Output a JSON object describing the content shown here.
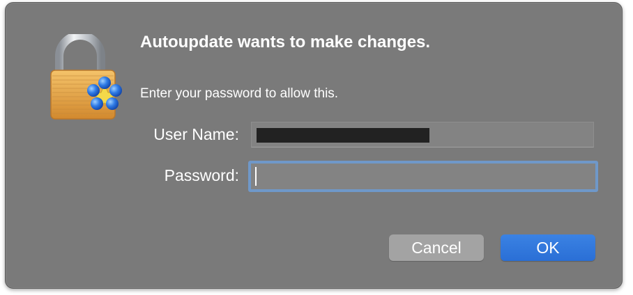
{
  "dialog": {
    "title": "Autoupdate wants to make changes.",
    "subtitle": "Enter your password to allow this.",
    "icon": "lock-icon"
  },
  "fields": {
    "username_label": "User Name:",
    "password_label": "Password:",
    "username_value": "",
    "password_value": ""
  },
  "buttons": {
    "cancel_label": "Cancel",
    "ok_label": "OK"
  },
  "colors": {
    "dialog_background": "#7a7a7a",
    "default_button": "#2a6fd6",
    "secondary_button": "#a3a3a3",
    "focus_ring": "#6f98c9",
    "redaction": "#222222"
  }
}
